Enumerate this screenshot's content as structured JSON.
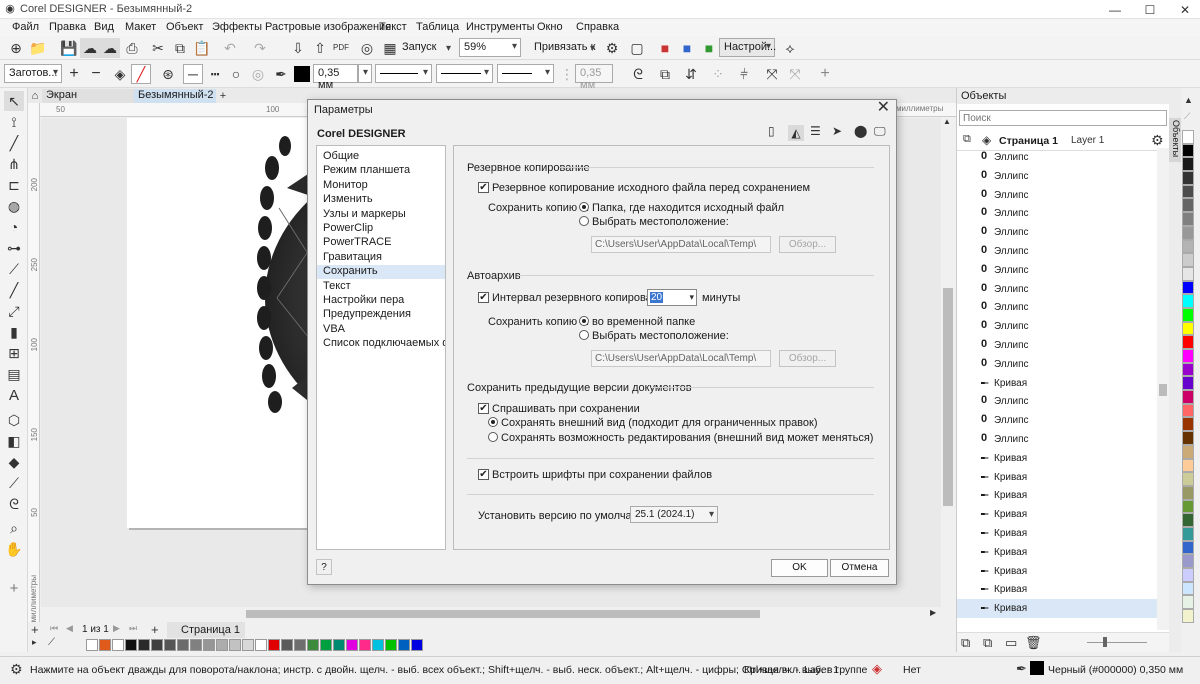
{
  "window": {
    "title": "Corel DESIGNER - Безымянный-2"
  },
  "menu": [
    "Файл",
    "Правка",
    "Вид",
    "Макет",
    "Объект",
    "Эффекты",
    "Растровые изображения",
    "Текст",
    "Таблица",
    "Инструменты",
    "Окно",
    "Справка"
  ],
  "toolbar1": {
    "launch": "Запуск",
    "zoom": "59%",
    "snap": "Привязать к",
    "settings": "Настрой..."
  },
  "toolbar2": {
    "preset": "Заготов...",
    "outline_width": "0,35 мм",
    "outline_width2": "0,35 мм"
  },
  "tabs": {
    "welcome": "Экран приветствия",
    "doc": "Безымянный-2"
  },
  "ruler_unit": "миллиметры",
  "ruler_h_ticks": [
    "50",
    "100"
  ],
  "ruler_v_ticks": [
    "200",
    "250",
    "100",
    "150",
    "50"
  ],
  "pagenav": {
    "counter": "1 из 1",
    "page_tab": "Страница 1"
  },
  "status": {
    "hint": "Нажмите на объект дважды для поворота/наклона; инстр. с двойн. щелч. - выб. всех объект.; Shift+щелч. - выб. неск. объект.; Alt+щелч. - цифры; Ctrl+щелч. - выб. в группе",
    "layer": "Кривая вкл. Layer 1",
    "fill": "Нет",
    "outline": "Черный (#000000)  0,350 мм"
  },
  "docker": {
    "title": "Объекты",
    "search_placeholder": "Поиск",
    "page": "Страница 1",
    "layer": "Layer 1",
    "side_tab": "Объекты",
    "items": [
      {
        "icon": "ellipse-icon",
        "label": "Эллипс"
      },
      {
        "icon": "ellipse-icon",
        "label": "Эллипс"
      },
      {
        "icon": "ellipse-icon",
        "label": "Эллипс"
      },
      {
        "icon": "ellipse-icon",
        "label": "Эллипс"
      },
      {
        "icon": "ellipse-icon",
        "label": "Эллипс"
      },
      {
        "icon": "ellipse-icon",
        "label": "Эллипс"
      },
      {
        "icon": "ellipse-icon",
        "label": "Эллипс"
      },
      {
        "icon": "ellipse-icon",
        "label": "Эллипс"
      },
      {
        "icon": "ellipse-icon",
        "label": "Эллипс"
      },
      {
        "icon": "ellipse-icon",
        "label": "Эллипс"
      },
      {
        "icon": "ellipse-icon",
        "label": "Эллипс"
      },
      {
        "icon": "ellipse-icon",
        "label": "Эллипс"
      },
      {
        "icon": "curve-icon",
        "label": "Кривая"
      },
      {
        "icon": "ellipse-icon",
        "label": "Эллипс"
      },
      {
        "icon": "ellipse-icon",
        "label": "Эллипс"
      },
      {
        "icon": "ellipse-icon",
        "label": "Эллипс"
      },
      {
        "icon": "curve-icon",
        "label": "Кривая"
      },
      {
        "icon": "curve-icon",
        "label": "Кривая"
      },
      {
        "icon": "curve-icon",
        "label": "Кривая"
      },
      {
        "icon": "curve-icon",
        "label": "Кривая"
      },
      {
        "icon": "curve-icon",
        "label": "Кривая"
      },
      {
        "icon": "curve-icon",
        "label": "Кривая"
      },
      {
        "icon": "curve-icon",
        "label": "Кривая"
      },
      {
        "icon": "curve-icon",
        "label": "Кривая"
      },
      {
        "icon": "curve-icon",
        "label": "Кривая"
      }
    ]
  },
  "palette_colors": [
    "#ffffff",
    "#e05a1c",
    "#ffffff",
    "#111111",
    "#2a2a2a",
    "#3f3f3f",
    "#555555",
    "#6b6b6b",
    "#808080",
    "#969696",
    "#acacac",
    "#c2c2c2",
    "#d8d8d8",
    "#ffffff",
    "#e00000",
    "#5a5a5a",
    "#6e6e6e",
    "#3c8a3c",
    "#00a040",
    "#008a70",
    "#e000e0",
    "#ff2a8a",
    "#00c0e0",
    "#00c000",
    "#0060c0",
    "#0000e0"
  ],
  "side_colors": [
    "#ffffff",
    "#000000",
    "#1a1a1a",
    "#333333",
    "#4d4d4d",
    "#666666",
    "#808080",
    "#999999",
    "#b3b3b3",
    "#cccccc",
    "#e6e6e6",
    "#0000ff",
    "#00ffff",
    "#00ff00",
    "#ffff00",
    "#ff0000",
    "#ff00ff",
    "#9900cc",
    "#6600cc",
    "#cc0066",
    "#ff6666",
    "#993300",
    "#663300",
    "#ccaa77",
    "#ffcc99",
    "#cccc99",
    "#999966",
    "#669933",
    "#336633",
    "#339999",
    "#3366cc",
    "#9999cc",
    "#ccccff",
    "#cce6ff",
    "#e6f2e6",
    "#f2f2cc"
  ],
  "dialog": {
    "title": "Параметры",
    "app": "Corel DESIGNER",
    "nav": [
      "Общие",
      "Режим планшета",
      "Монитор",
      "Изменить",
      "Узлы и маркеры",
      "PowerClip",
      "PowerTRACE",
      "Гравитация",
      "Сохранить",
      "Текст",
      "Настройки пера",
      "Предупреждения",
      "VBA",
      "Список подключаемых фил..."
    ],
    "nav_selected": 8,
    "backup": {
      "title": "Резервное копирование",
      "check": "Резервное копирование исходного файла перед сохранением",
      "save_copy": "Сохранить копию в:",
      "opt1": "Папка, где находится исходный файл",
      "opt2": "Выбрать местоположение:",
      "path": "C:\\Users\\User\\AppData\\Local\\Temp\\",
      "browse": "Обзор..."
    },
    "autosave": {
      "title": "Автоархив",
      "check": "Интервал резервного копирования:",
      "interval": "20",
      "units": "минуты",
      "save_copy": "Сохранить копию в:",
      "opt1": "во временной папке",
      "opt2": "Выбрать местоположение:",
      "path": "C:\\Users\\User\\AppData\\Local\\Temp\\",
      "browse": "Обзор..."
    },
    "versions": {
      "title": "Сохранить предыдущие версии документов",
      "check": "Спрашивать при сохранении",
      "opt1": "Сохранять внешний вид (подходит для ограниченных правок)",
      "opt2": "Сохранять возможность редактирования (внешний вид может меняться)"
    },
    "embed": "Встроить шрифты при сохранении файлов",
    "default_version_label": "Установить версию по умолчанию:",
    "default_version": "25.1 (2024.1)",
    "help": "?",
    "ok": "OK",
    "cancel": "Отмена"
  }
}
